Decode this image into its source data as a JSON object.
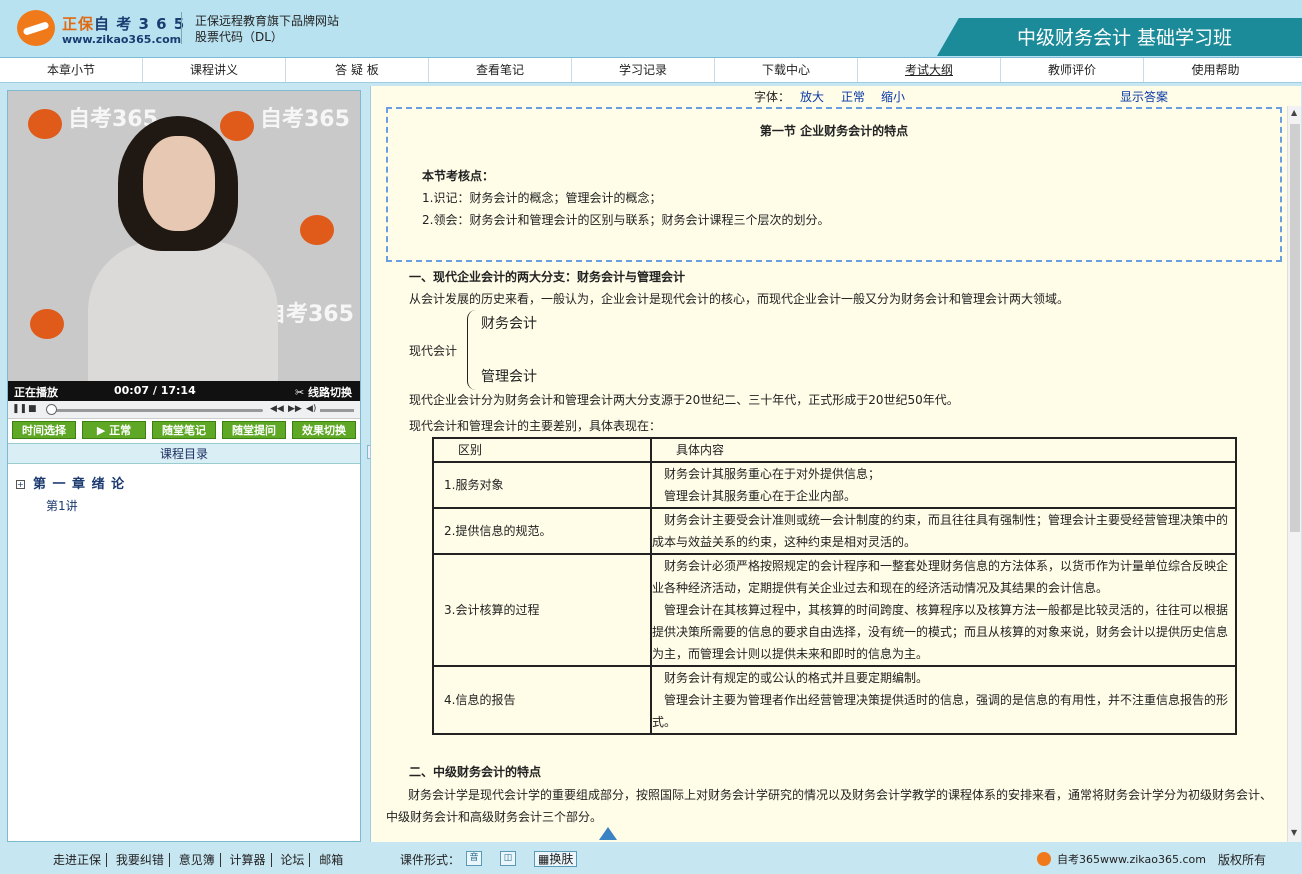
{
  "header": {
    "brand_name": "正保",
    "brand_suffix": "自 考 3 6 5",
    "brand_url": "www.zikao365.com",
    "tagline": "正保远程教育旗下品牌网站",
    "stock": "股票代码（DL）",
    "course_title": "中级财务会计 基础学习班"
  },
  "nav": [
    "本章小节",
    "课程讲义",
    "答 疑 板",
    "查看笔记",
    "学习记录",
    "下载中心",
    "考试大纲",
    "教师评价",
    "使用帮助"
  ],
  "video": {
    "watermark_a": "自考365",
    "watermark_url": "www.zikao365.com",
    "status": "正在播放",
    "time_current": "00:07",
    "time_sep": " / ",
    "time_total": "17:14",
    "switch_line": "线路切换"
  },
  "video_buttons": [
    "时间选择",
    "正常",
    "随堂笔记",
    "随堂提问",
    "效果切换"
  ],
  "toc": {
    "title": "课程目录",
    "chapter": "第 一 章  绪 论",
    "lecture": "第1讲"
  },
  "fontbar": {
    "font_label": "字体：",
    "enlarge": "放大",
    "normal": "正常",
    "shrink": "缩小",
    "show_answer": "显示答案"
  },
  "content": {
    "section_title": "第一节  企业财务会计的特点",
    "key_points_head": "本节考核点：",
    "key_point_1": "1.识记：财务会计的概念；管理会计的概念；",
    "key_point_2": "2.领会：财务会计和管理会计的区别与联系；财务会计课程三个层次的划分。",
    "heading_1": "一、现代企业会计的两大分支：财务会计与管理会计",
    "para_1": "从会计发展的历史来看，一般认为，企业会计是现代会计的核心，而现代企业会计一般又分为财务会计和管理会计两大领域。",
    "brace_root": "现代会计",
    "brace_top": "财务会计",
    "brace_bottom": "管理会计",
    "para_2": "现代企业会计分为财务会计和管理会计两大分支源于20世纪二、三十年代，正式形成于20世纪50年代。",
    "para_3": "现代会计和管理会计的主要差别，具体表现在：",
    "table_head": [
      "区别",
      "具体内容"
    ],
    "table_rows": [
      {
        "label": "1.服务对象",
        "lines": [
          "财务会计其服务重心在于对外提供信息；",
          "管理会计其服务重心在于企业内部。"
        ]
      },
      {
        "label": "2.提供信息的规范。",
        "lines": [
          "财务会计主要受会计准则或统一会计制度的约束，而且往往具有强制性；管理会计主要受经营管理决策中的成本与效益关系的约束，这种约束是相对灵活的。"
        ]
      },
      {
        "label": "3.会计核算的过程",
        "lines": [
          "财务会计必须严格按照规定的会计程序和一整套处理财务信息的方法体系，以货币作为计量单位综合反映企业各种经济活动，定期提供有关企业过去和现在的经济活动情况及其结果的会计信息。",
          "管理会计在其核算过程中，其核算的时间跨度、核算程序以及核算方法一般都是比较灵活的，往往可以根据提供决策所需要的信息的要求自由选择，没有统一的模式；而且从核算的对象来说，财务会计以提供历史信息为主，而管理会计则以提供未来和即时的信息为主。"
        ]
      },
      {
        "label": "4.信息的报告",
        "lines": [
          "财务会计有规定的或公认的格式并且要定期编制。",
          "管理会计主要为管理者作出经营管理决策提供适时的信息，强调的是信息的有用性，并不注重信息报告的形式。"
        ]
      }
    ],
    "heading_2": "二、中级财务会计的特点",
    "para_4": "财务会计学是现代会计学的重要组成部分，按照国际上对财务会计学研究的情况以及财务会计学教学的课程体系的安排来看，通常将财务会计学分为初级财务会计、中级财务会计和高级财务会计三个部分。"
  },
  "footer": {
    "links": [
      "走进正保",
      "我要纠错",
      "意见簿",
      "计算器",
      "论坛",
      "邮箱"
    ],
    "form_label": "课件形式：",
    "icon_audio": "音",
    "skin": "换肤",
    "brand": "自考365www.zikao365.com",
    "copyright": "版权所有"
  },
  "colors": {
    "accent": "#1b8b9a",
    "header_bg": "#b9e2f1",
    "button_green": "#5fa826",
    "content_bg": "#fffce8"
  }
}
